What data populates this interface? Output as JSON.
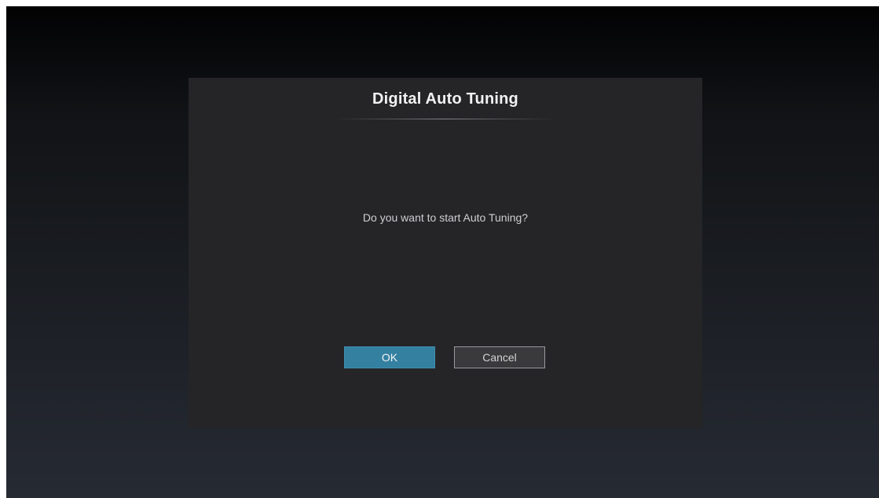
{
  "dialog": {
    "title": "Digital Auto Tuning",
    "message": "Do you want to start Auto Tuning?",
    "buttons": {
      "ok_label": "OK",
      "cancel_label": "Cancel"
    }
  },
  "colors": {
    "dialog_background": "#252528",
    "ok_button": "#3480a0",
    "cancel_border": "#9a9a9e",
    "title_text": "#f2f2f2"
  }
}
